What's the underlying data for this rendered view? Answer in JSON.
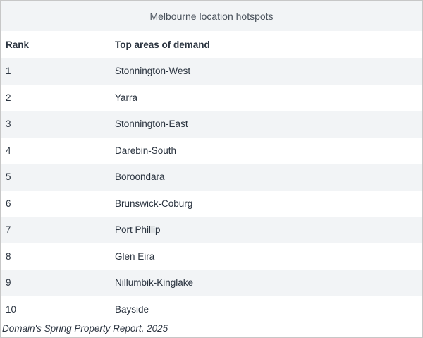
{
  "table": {
    "title": "Melbourne location hotspots",
    "headers": {
      "rank": "Rank",
      "area": "Top areas of demand"
    },
    "rows": [
      {
        "rank": "1",
        "area": "Stonnington-West"
      },
      {
        "rank": "2",
        "area": "Yarra"
      },
      {
        "rank": "3",
        "area": "Stonnington-East"
      },
      {
        "rank": "4",
        "area": "Darebin-South"
      },
      {
        "rank": "5",
        "area": "Boroondara"
      },
      {
        "rank": "6",
        "area": "Brunswick-Coburg"
      },
      {
        "rank": "7",
        "area": "Port Phillip"
      },
      {
        "rank": "8",
        "area": "Glen Eira"
      },
      {
        "rank": "9",
        "area": "Nillumbik-Kinglake"
      },
      {
        "rank": "10",
        "area": "Bayside"
      }
    ]
  },
  "source": "Domain's Spring Property Report, 2025"
}
